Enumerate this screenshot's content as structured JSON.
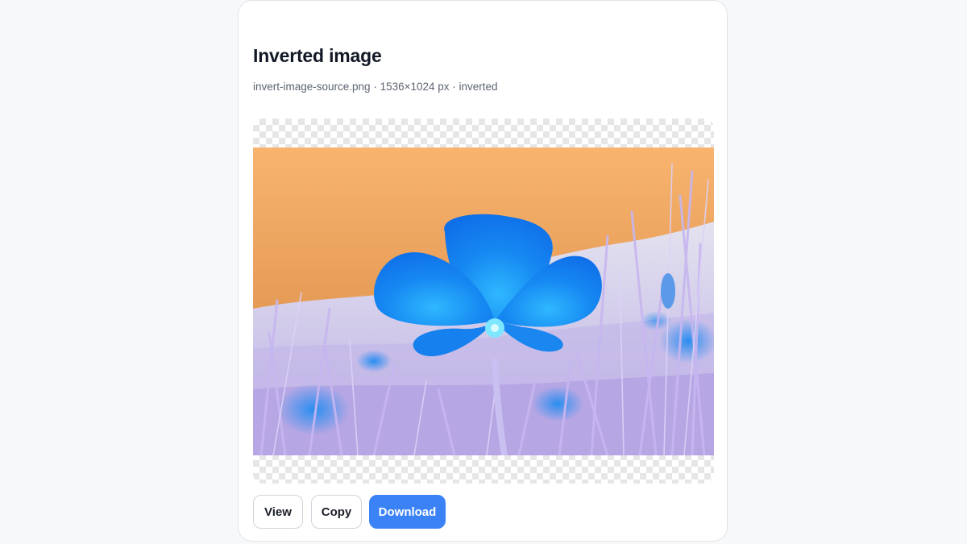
{
  "card": {
    "title": "Inverted image",
    "meta": "invert-image-source.png · 1536×1024 px · inverted"
  },
  "preview": {
    "alt": "Inverted photo of a poppy flower",
    "checker_color": "#e6e6e6"
  },
  "actions": {
    "view_label": "View",
    "copy_label": "Copy",
    "download_label": "Download"
  },
  "colors": {
    "accent": "#3b82f6",
    "title": "#121826",
    "muted": "#5c6470"
  }
}
